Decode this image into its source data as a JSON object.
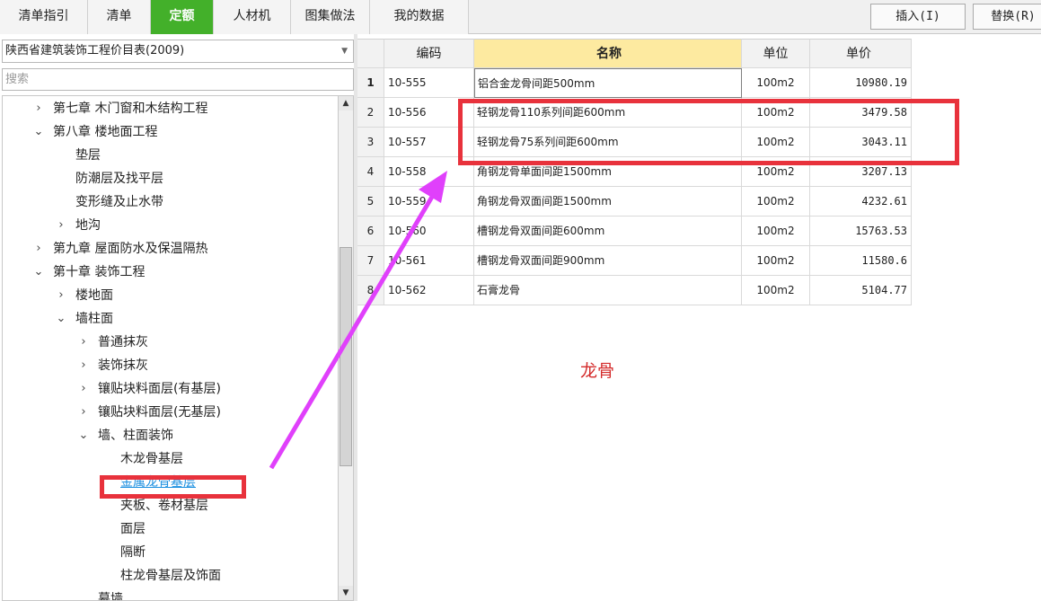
{
  "tabs": [
    {
      "label": "清单指引"
    },
    {
      "label": "清单"
    },
    {
      "label": "定额"
    },
    {
      "label": "人材机"
    },
    {
      "label": "图集做法"
    },
    {
      "label": "我的数据"
    }
  ],
  "toolbar": {
    "insert_label": "插入(I)",
    "replace_label": "替换(R)"
  },
  "left": {
    "library_select": "陕西省建筑装饰工程价目表(2009)",
    "search_placeholder": "搜索",
    "tree": [
      {
        "label": "第七章 木门窗和木结构工程",
        "expanded": false
      },
      {
        "label": "第八章 楼地面工程",
        "expanded": true
      },
      {
        "label": "垫层"
      },
      {
        "label": "防潮层及找平层"
      },
      {
        "label": "变形缝及止水带"
      },
      {
        "label": "地沟",
        "expanded": false
      },
      {
        "label": "第九章 屋面防水及保温隔热",
        "expanded": false
      },
      {
        "label": "第十章 装饰工程",
        "expanded": true
      },
      {
        "label": "楼地面",
        "expanded": false
      },
      {
        "label": "墙柱面",
        "expanded": true
      },
      {
        "label": "普通抹灰",
        "expanded": false
      },
      {
        "label": "装饰抹灰",
        "expanded": false
      },
      {
        "label": "镶贴块料面层(有基层)",
        "expanded": false
      },
      {
        "label": "镶贴块料面层(无基层)",
        "expanded": false
      },
      {
        "label": "墙、柱面装饰",
        "expanded": true
      },
      {
        "label": "木龙骨基层"
      },
      {
        "label": "金属龙骨基层",
        "selected": true
      },
      {
        "label": "夹板、卷材基层"
      },
      {
        "label": "面层"
      },
      {
        "label": "隔断"
      },
      {
        "label": "柱龙骨基层及饰面"
      },
      {
        "label": "幕墙"
      }
    ]
  },
  "grid": {
    "headers": {
      "code": "编码",
      "name": "名称",
      "unit": "单位",
      "price": "单价"
    },
    "rows": [
      {
        "no": "1",
        "code": "10-555",
        "name": "铝合金龙骨间距500mm",
        "unit": "100m2",
        "price": "10980.19"
      },
      {
        "no": "2",
        "code": "10-556",
        "name": "轻钢龙骨110系列间距600mm",
        "unit": "100m2",
        "price": "3479.58"
      },
      {
        "no": "3",
        "code": "10-557",
        "name": "轻钢龙骨75系列间距600mm",
        "unit": "100m2",
        "price": "3043.11"
      },
      {
        "no": "4",
        "code": "10-558",
        "name": "角钢龙骨单面间距1500mm",
        "unit": "100m2",
        "price": "3207.13"
      },
      {
        "no": "5",
        "code": "10-559",
        "name": "角钢龙骨双面间距1500mm",
        "unit": "100m2",
        "price": "4232.61"
      },
      {
        "no": "6",
        "code": "10-560",
        "name": "槽钢龙骨双面间距600mm",
        "unit": "100m2",
        "price": "15763.53"
      },
      {
        "no": "7",
        "code": "10-561",
        "name": "槽钢龙骨双面间距900mm",
        "unit": "100m2",
        "price": "11580.6"
      },
      {
        "no": "8",
        "code": "10-562",
        "name": "石膏龙骨",
        "unit": "100m2",
        "price": "5104.77"
      }
    ]
  },
  "annotation": {
    "text": "龙骨",
    "color": "#e8323c",
    "arrow_color": "#e040fb"
  },
  "colors": {
    "active_tab": "#43b02a",
    "name_header": "#fdeaa0",
    "selected_link": "#1b8fe0"
  }
}
